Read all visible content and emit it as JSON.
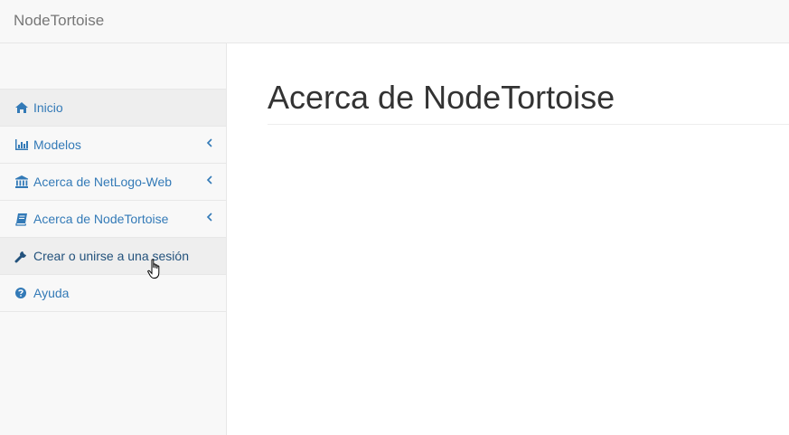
{
  "navbar": {
    "brand": "NodeTortoise"
  },
  "sidebar": {
    "items": [
      {
        "label": "Inicio",
        "icon": "home-icon",
        "state": "active",
        "has_submenu": false
      },
      {
        "label": "Modelos",
        "icon": "bar-chart-icon",
        "state": "normal",
        "has_submenu": true
      },
      {
        "label": "Acerca de NetLogo-Web",
        "icon": "institution-icon",
        "state": "normal",
        "has_submenu": true
      },
      {
        "label": "Acerca de NodeTortoise",
        "icon": "book-icon",
        "state": "normal",
        "has_submenu": true
      },
      {
        "label": "Crear o unirse a una sesión",
        "icon": "wrench-icon",
        "state": "hover",
        "has_submenu": false
      },
      {
        "label": "Ayuda",
        "icon": "question-circle-icon",
        "state": "normal",
        "has_submenu": false
      }
    ]
  },
  "main": {
    "title": "Acerca de NodeTortoise"
  },
  "colors": {
    "link": "#337ab7",
    "link_hover": "#23527c",
    "brand_text": "#777777",
    "sidebar_bg": "#f8f8f8",
    "active_bg": "#eeeeee",
    "border": "#e7e7e7",
    "title_text": "#333333"
  }
}
